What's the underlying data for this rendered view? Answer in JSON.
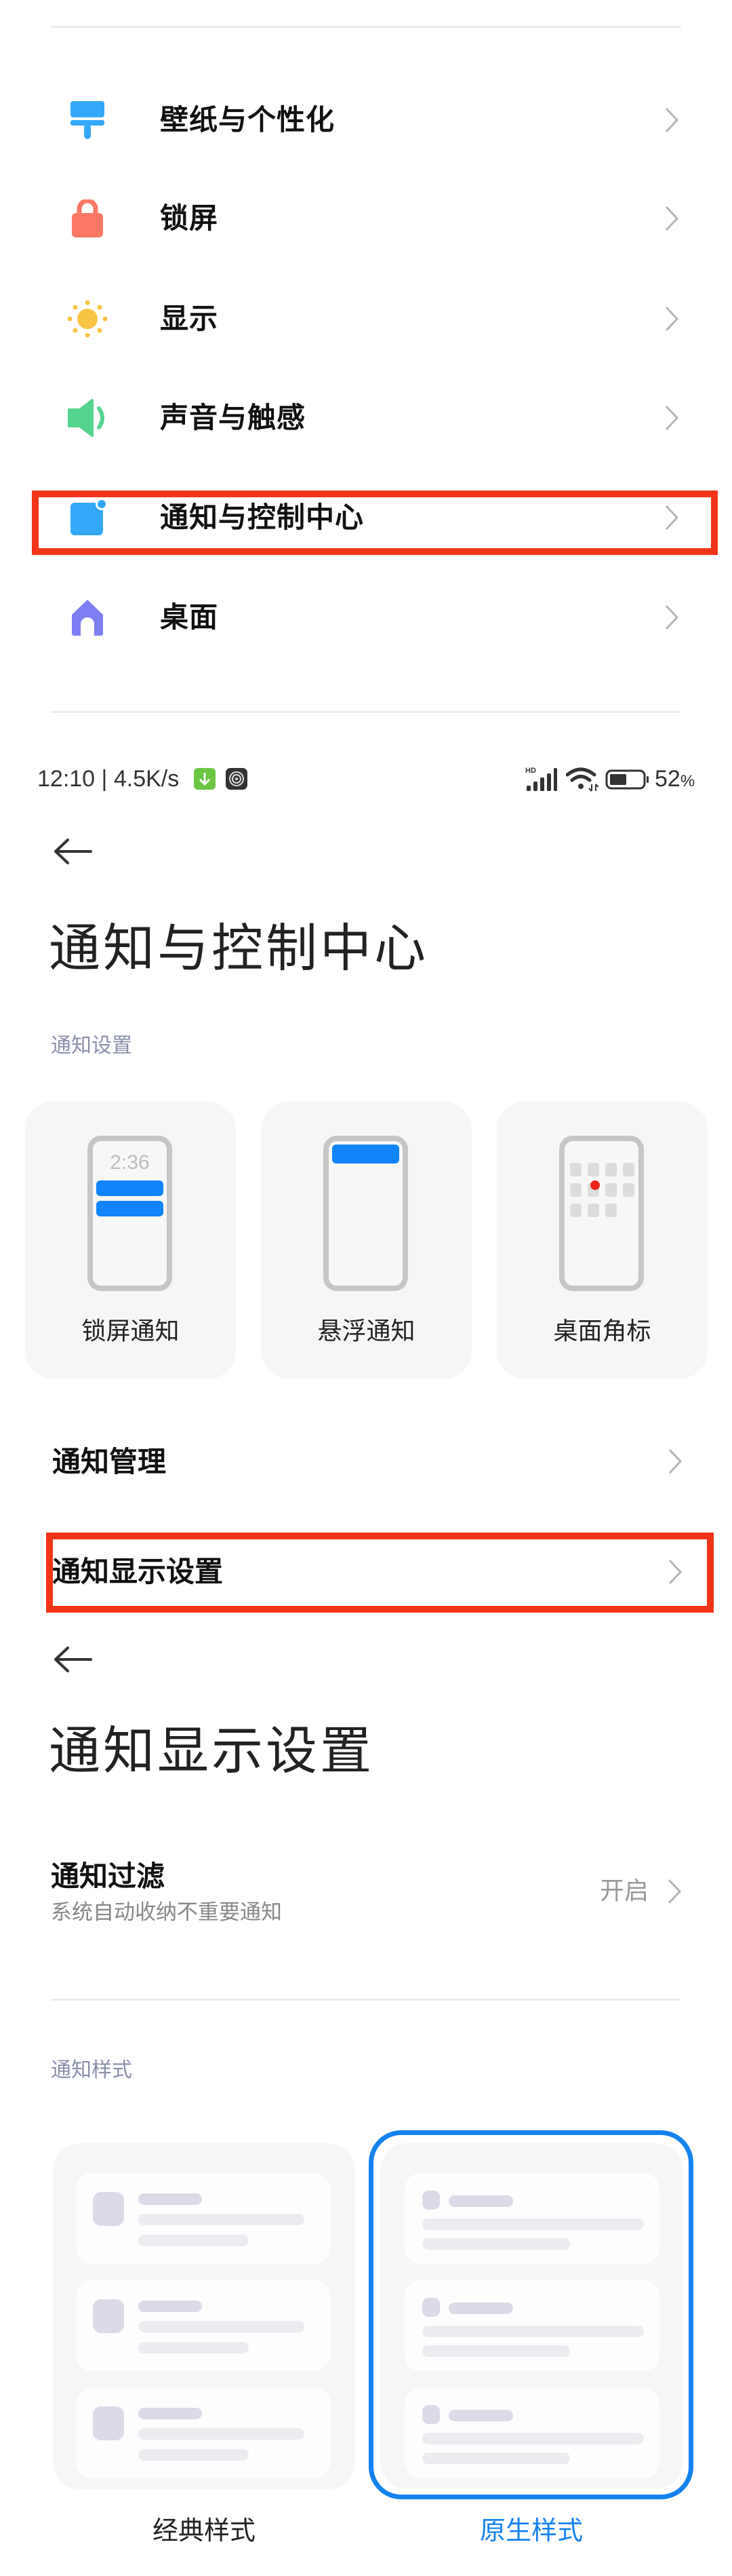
{
  "settings_menu": {
    "items": [
      {
        "label": "壁纸与个性化",
        "icon": "wallpaper-brush-icon",
        "color": "#34a8f8"
      },
      {
        "label": "锁屏",
        "icon": "lock-icon",
        "color": "#fb7866"
      },
      {
        "label": "显示",
        "icon": "sun-icon",
        "color": "#f8c443"
      },
      {
        "label": "声音与触感",
        "icon": "speaker-icon",
        "color": "#55d48e"
      },
      {
        "label": "通知与控制中心",
        "icon": "notification-icon",
        "color": "#34a8f8",
        "highlighted": true
      },
      {
        "label": "桌面",
        "icon": "home-icon",
        "color": "#7e7ef5"
      }
    ]
  },
  "status_bar": {
    "time": "12:10",
    "separator": "|",
    "net_speed": "4.5K/s",
    "icons": [
      "download-icon",
      "app-swirl-icon",
      "hd-signal-icon",
      "wifi-icon",
      "battery-icon"
    ],
    "signal_label": "HD",
    "battery_percent": 52,
    "battery_text": "52",
    "battery_unit": "%"
  },
  "notif_center_page": {
    "title": "通知与控制中心",
    "section_label": "通知设置",
    "cards": [
      {
        "label": "锁屏通知",
        "preview_time": "2:36"
      },
      {
        "label": "悬浮通知"
      },
      {
        "label": "桌面角标"
      }
    ],
    "rows": [
      {
        "label": "通知管理"
      },
      {
        "label": "通知显示设置",
        "highlighted": true
      }
    ]
  },
  "notif_display_page": {
    "title": "通知显示设置",
    "filter": {
      "title": "通知过滤",
      "subtitle": "系统自动收纳不重要通知",
      "value": "开启"
    },
    "style_section_label": "通知样式",
    "styles": [
      {
        "label": "经典样式",
        "selected": false
      },
      {
        "label": "原生样式",
        "selected": true
      }
    ],
    "accent_color": "#1582f0",
    "highlight_color": "#f23518"
  }
}
